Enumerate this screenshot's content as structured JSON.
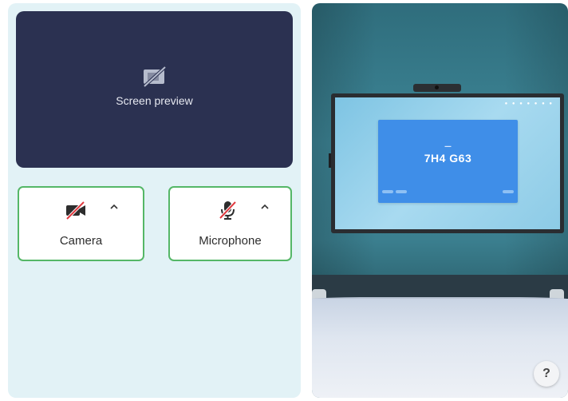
{
  "preview": {
    "label": "Screen preview",
    "icon": "screen-off-icon"
  },
  "devices": {
    "camera": {
      "label": "Camera",
      "icon": "camera-off-icon",
      "expand_icon": "chevron-up-icon",
      "status": "off"
    },
    "microphone": {
      "label": "Microphone",
      "icon": "microphone-off-icon",
      "expand_icon": "chevron-up-icon",
      "status": "off"
    }
  },
  "room_display": {
    "code": "7H4 G63"
  },
  "help": {
    "label": "?"
  },
  "colors": {
    "panel_bg": "#e2f2f6",
    "preview_bg": "#2b3151",
    "device_border": "#55b767",
    "mute_red": "#e0383e"
  }
}
